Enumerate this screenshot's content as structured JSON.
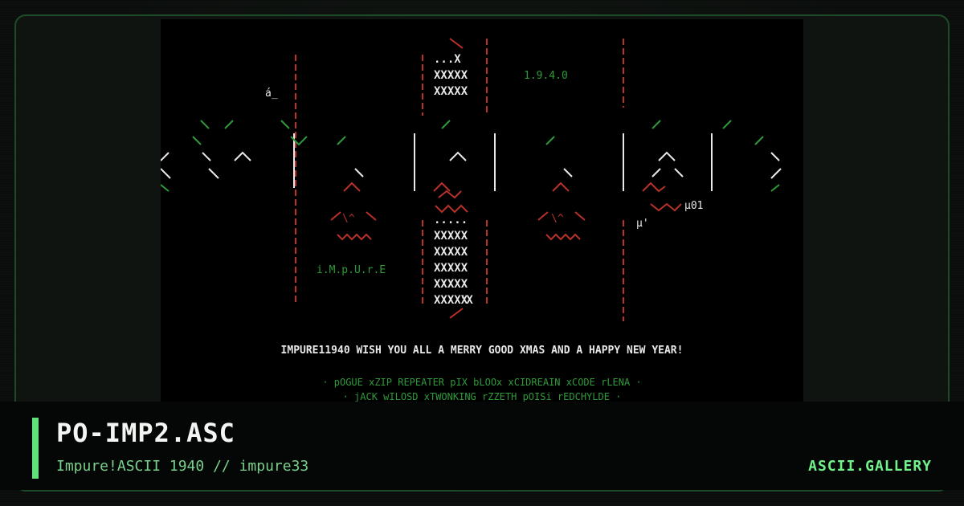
{
  "art": {
    "version_tag": "1.9.4.0",
    "group_tag": "i.M.p.U.r.E",
    "side_tag_left": "á_",
    "side_tag_right": "µ01",
    "side_tag_right2": "µ'",
    "top_box": "...X",
    "box_rows": [
      "XXXXX",
      "XXXXX"
    ],
    "bottom_box_head": ".....",
    "bottom_box_rows": [
      "XXXXX",
      "XXXXX",
      "XXXXX",
      "XXXXX",
      "XXXXX"
    ],
    "bottom_box_tail": "'X",
    "greeting": "IMPURE11940 WISH YOU ALL A MERRY GOOD XMAS AND A HAPPY NEW YEAR!",
    "members_row1": "· pOGUE   xZIP   REPEATER   pIX   bLOOx   xCIDREAIN   xCODE   rLENA ·",
    "members_row2": "· jACK wILOSD   xTWONKING   rZZETH   pOISi   rEDCHYLDE ·"
  },
  "footer": {
    "title": "PO-IMP2.ASC",
    "subtitle": "Impure!ASCII 1940 // impure33",
    "brand": "ASCII.GALLERY"
  },
  "colors": {
    "accent": "#5fe07a",
    "art_red": "#b8322a",
    "art_green": "#2f9a3a",
    "art_white": "#e8e8e8"
  }
}
